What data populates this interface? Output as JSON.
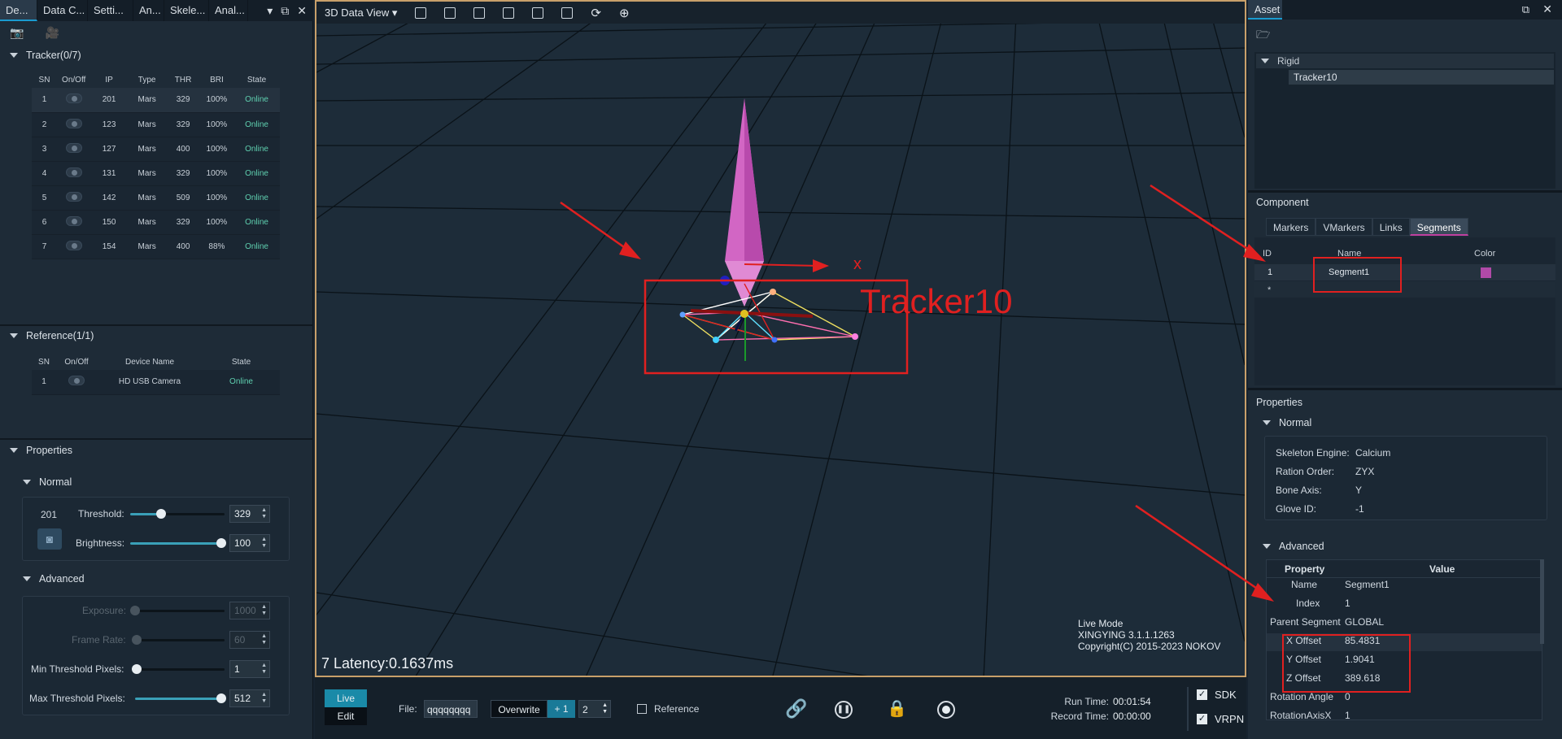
{
  "left": {
    "tabs": [
      "De...",
      "Data C...",
      "Setti...",
      "An...",
      "Skele...",
      "Anal..."
    ],
    "tracker_section": "Tracker(0/7)",
    "tracker_headers": [
      "SN",
      "On/Off",
      "IP",
      "Type",
      "THR",
      "BRI",
      "State"
    ],
    "trackers": [
      [
        "1",
        "201",
        "Mars",
        "329",
        "100%",
        "Online"
      ],
      [
        "2",
        "123",
        "Mars",
        "329",
        "100%",
        "Online"
      ],
      [
        "3",
        "127",
        "Mars",
        "400",
        "100%",
        "Online"
      ],
      [
        "4",
        "131",
        "Mars",
        "329",
        "100%",
        "Online"
      ],
      [
        "5",
        "142",
        "Mars",
        "509",
        "100%",
        "Online"
      ],
      [
        "6",
        "150",
        "Mars",
        "329",
        "100%",
        "Online"
      ],
      [
        "7",
        "154",
        "Mars",
        "400",
        "88%",
        "Online"
      ]
    ],
    "reference_section": "Reference(1/1)",
    "reference_headers": [
      "SN",
      "On/Off",
      "Device Name",
      "State"
    ],
    "references": [
      [
        "1",
        "HD USB Camera",
        "Online"
      ]
    ],
    "properties_section": "Properties",
    "normal_label": "Normal",
    "device_id": "201",
    "threshold_label": "Threshold:",
    "threshold_value": "329",
    "threshold_fraction": 0.33,
    "brightness_label": "Brightness:",
    "brightness_value": "100",
    "brightness_fraction": 1.0,
    "advanced_label": "Advanced",
    "exposure_label": "Exposure:",
    "exposure_value": "1000",
    "framerate_label": "Frame Rate:",
    "framerate_value": "60",
    "min_thr_label": "Min Threshold Pixels:",
    "min_thr_value": "1",
    "max_thr_label": "Max Threshold Pixels:",
    "max_thr_value": "512"
  },
  "view": {
    "title": "3D Data View",
    "axis_label": "x",
    "tracker_name": "Tracker10",
    "latency": "7 Latency:0.1637ms",
    "mode": "Live Mode",
    "version": "XINGYING 3.1.1.1263",
    "copyright": "Copyright(C) 2015-2023 NOKOV"
  },
  "bottom": {
    "live": "Live",
    "edit": "Edit",
    "file_label": "File:",
    "file_value": "qqqqqqqq",
    "overwrite": "Overwrite",
    "plus_one": "+ 1",
    "count": "2",
    "reference": "Reference",
    "run_time_label": "Run Time:",
    "run_time": "00:01:54",
    "record_time_label": "Record Time:",
    "record_time": "00:00:00",
    "sdk": "SDK",
    "vrpn": "VRPN"
  },
  "right": {
    "tab": "Asset",
    "rigid": "Rigid",
    "tracker": "Tracker10",
    "component": "Component",
    "subtabs": [
      "Markers",
      "VMarkers",
      "Links",
      "Segments"
    ],
    "seg_headers": [
      "ID",
      "Name",
      "Color"
    ],
    "seg_id": "1",
    "seg_name": "Segment1",
    "seg_color": "#b04aa8",
    "seg_new": "*",
    "properties": "Properties",
    "normal": "Normal",
    "normal_props": [
      [
        "Skeleton Engine:",
        "Calcium"
      ],
      [
        "Ration Order:",
        "ZYX"
      ],
      [
        "Bone Axis:",
        "Y"
      ],
      [
        "Glove ID:",
        "-1"
      ]
    ],
    "advanced": "Advanced",
    "adv_header_property": "Property",
    "adv_header_value": "Value",
    "adv_props": [
      [
        "Name",
        "Segment1"
      ],
      [
        "Index",
        "1"
      ],
      [
        "Parent Segment",
        "GLOBAL"
      ],
      [
        "X Offset",
        "85.4831"
      ],
      [
        "Y Offset",
        "1.9041"
      ],
      [
        "Z Offset",
        "389.618"
      ],
      [
        "Rotation Angle",
        "0"
      ],
      [
        "RotationAxisX",
        "1"
      ]
    ]
  }
}
